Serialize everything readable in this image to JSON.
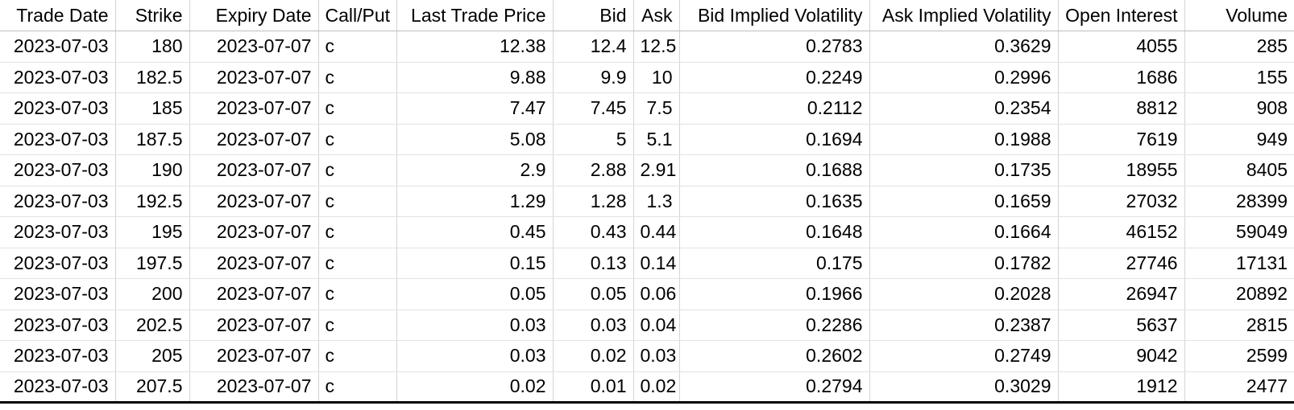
{
  "table": {
    "columns": [
      {
        "key": "trade_date",
        "label": "Trade Date",
        "align": "right",
        "class": "col-trade-date"
      },
      {
        "key": "strike",
        "label": "Strike",
        "align": "right",
        "class": "col-strike"
      },
      {
        "key": "expiry_date",
        "label": "Expiry Date",
        "align": "right",
        "class": "col-expiry-date"
      },
      {
        "key": "call_put",
        "label": "Call/Put",
        "align": "left",
        "class": "col-callput"
      },
      {
        "key": "last_trade",
        "label": "Last Trade Price",
        "align": "right",
        "class": "col-last-trade"
      },
      {
        "key": "bid",
        "label": "Bid",
        "align": "right",
        "class": "col-bid"
      },
      {
        "key": "ask",
        "label": "Ask",
        "align": "right",
        "class": "col-ask"
      },
      {
        "key": "bid_iv",
        "label": "Bid Implied Volatility",
        "align": "right",
        "class": "col-bid-iv"
      },
      {
        "key": "ask_iv",
        "label": "Ask Implied Volatility",
        "align": "right",
        "class": "col-ask-iv"
      },
      {
        "key": "open_interest",
        "label": "Open Interest",
        "align": "right",
        "class": "col-open-interest"
      },
      {
        "key": "volume",
        "label": "Volume",
        "align": "right",
        "class": "col-volume"
      }
    ],
    "rows": [
      {
        "trade_date": "2023-07-03",
        "strike": "180",
        "expiry_date": "2023-07-07",
        "call_put": "c",
        "last_trade": "12.38",
        "bid": "12.4",
        "ask": "12.5",
        "bid_iv": "0.2783",
        "ask_iv": "0.3629",
        "open_interest": "4055",
        "volume": "285"
      },
      {
        "trade_date": "2023-07-03",
        "strike": "182.5",
        "expiry_date": "2023-07-07",
        "call_put": "c",
        "last_trade": "9.88",
        "bid": "9.9",
        "ask": "10",
        "bid_iv": "0.2249",
        "ask_iv": "0.2996",
        "open_interest": "1686",
        "volume": "155"
      },
      {
        "trade_date": "2023-07-03",
        "strike": "185",
        "expiry_date": "2023-07-07",
        "call_put": "c",
        "last_trade": "7.47",
        "bid": "7.45",
        "ask": "7.5",
        "bid_iv": "0.2112",
        "ask_iv": "0.2354",
        "open_interest": "8812",
        "volume": "908"
      },
      {
        "trade_date": "2023-07-03",
        "strike": "187.5",
        "expiry_date": "2023-07-07",
        "call_put": "c",
        "last_trade": "5.08",
        "bid": "5",
        "ask": "5.1",
        "bid_iv": "0.1694",
        "ask_iv": "0.1988",
        "open_interest": "7619",
        "volume": "949"
      },
      {
        "trade_date": "2023-07-03",
        "strike": "190",
        "expiry_date": "2023-07-07",
        "call_put": "c",
        "last_trade": "2.9",
        "bid": "2.88",
        "ask": "2.91",
        "bid_iv": "0.1688",
        "ask_iv": "0.1735",
        "open_interest": "18955",
        "volume": "8405"
      },
      {
        "trade_date": "2023-07-03",
        "strike": "192.5",
        "expiry_date": "2023-07-07",
        "call_put": "c",
        "last_trade": "1.29",
        "bid": "1.28",
        "ask": "1.3",
        "bid_iv": "0.1635",
        "ask_iv": "0.1659",
        "open_interest": "27032",
        "volume": "28399"
      },
      {
        "trade_date": "2023-07-03",
        "strike": "195",
        "expiry_date": "2023-07-07",
        "call_put": "c",
        "last_trade": "0.45",
        "bid": "0.43",
        "ask": "0.44",
        "bid_iv": "0.1648",
        "ask_iv": "0.1664",
        "open_interest": "46152",
        "volume": "59049"
      },
      {
        "trade_date": "2023-07-03",
        "strike": "197.5",
        "expiry_date": "2023-07-07",
        "call_put": "c",
        "last_trade": "0.15",
        "bid": "0.13",
        "ask": "0.14",
        "bid_iv": "0.175",
        "ask_iv": "0.1782",
        "open_interest": "27746",
        "volume": "17131"
      },
      {
        "trade_date": "2023-07-03",
        "strike": "200",
        "expiry_date": "2023-07-07",
        "call_put": "c",
        "last_trade": "0.05",
        "bid": "0.05",
        "ask": "0.06",
        "bid_iv": "0.1966",
        "ask_iv": "0.2028",
        "open_interest": "26947",
        "volume": "20892"
      },
      {
        "trade_date": "2023-07-03",
        "strike": "202.5",
        "expiry_date": "2023-07-07",
        "call_put": "c",
        "last_trade": "0.03",
        "bid": "0.03",
        "ask": "0.04",
        "bid_iv": "0.2286",
        "ask_iv": "0.2387",
        "open_interest": "5637",
        "volume": "2815"
      },
      {
        "trade_date": "2023-07-03",
        "strike": "205",
        "expiry_date": "2023-07-07",
        "call_put": "c",
        "last_trade": "0.03",
        "bid": "0.02",
        "ask": "0.03",
        "bid_iv": "0.2602",
        "ask_iv": "0.2749",
        "open_interest": "9042",
        "volume": "2599"
      },
      {
        "trade_date": "2023-07-03",
        "strike": "207.5",
        "expiry_date": "2023-07-07",
        "call_put": "c",
        "last_trade": "0.02",
        "bid": "0.01",
        "ask": "0.02",
        "bid_iv": "0.2794",
        "ask_iv": "0.3029",
        "open_interest": "1912",
        "volume": "2477"
      }
    ]
  },
  "colors": {
    "text": "#000000",
    "background": "#ffffff",
    "cell_border": "#e2e2e2",
    "column_border": "#d4d4d4",
    "table_bottom_rule": "#000000"
  }
}
